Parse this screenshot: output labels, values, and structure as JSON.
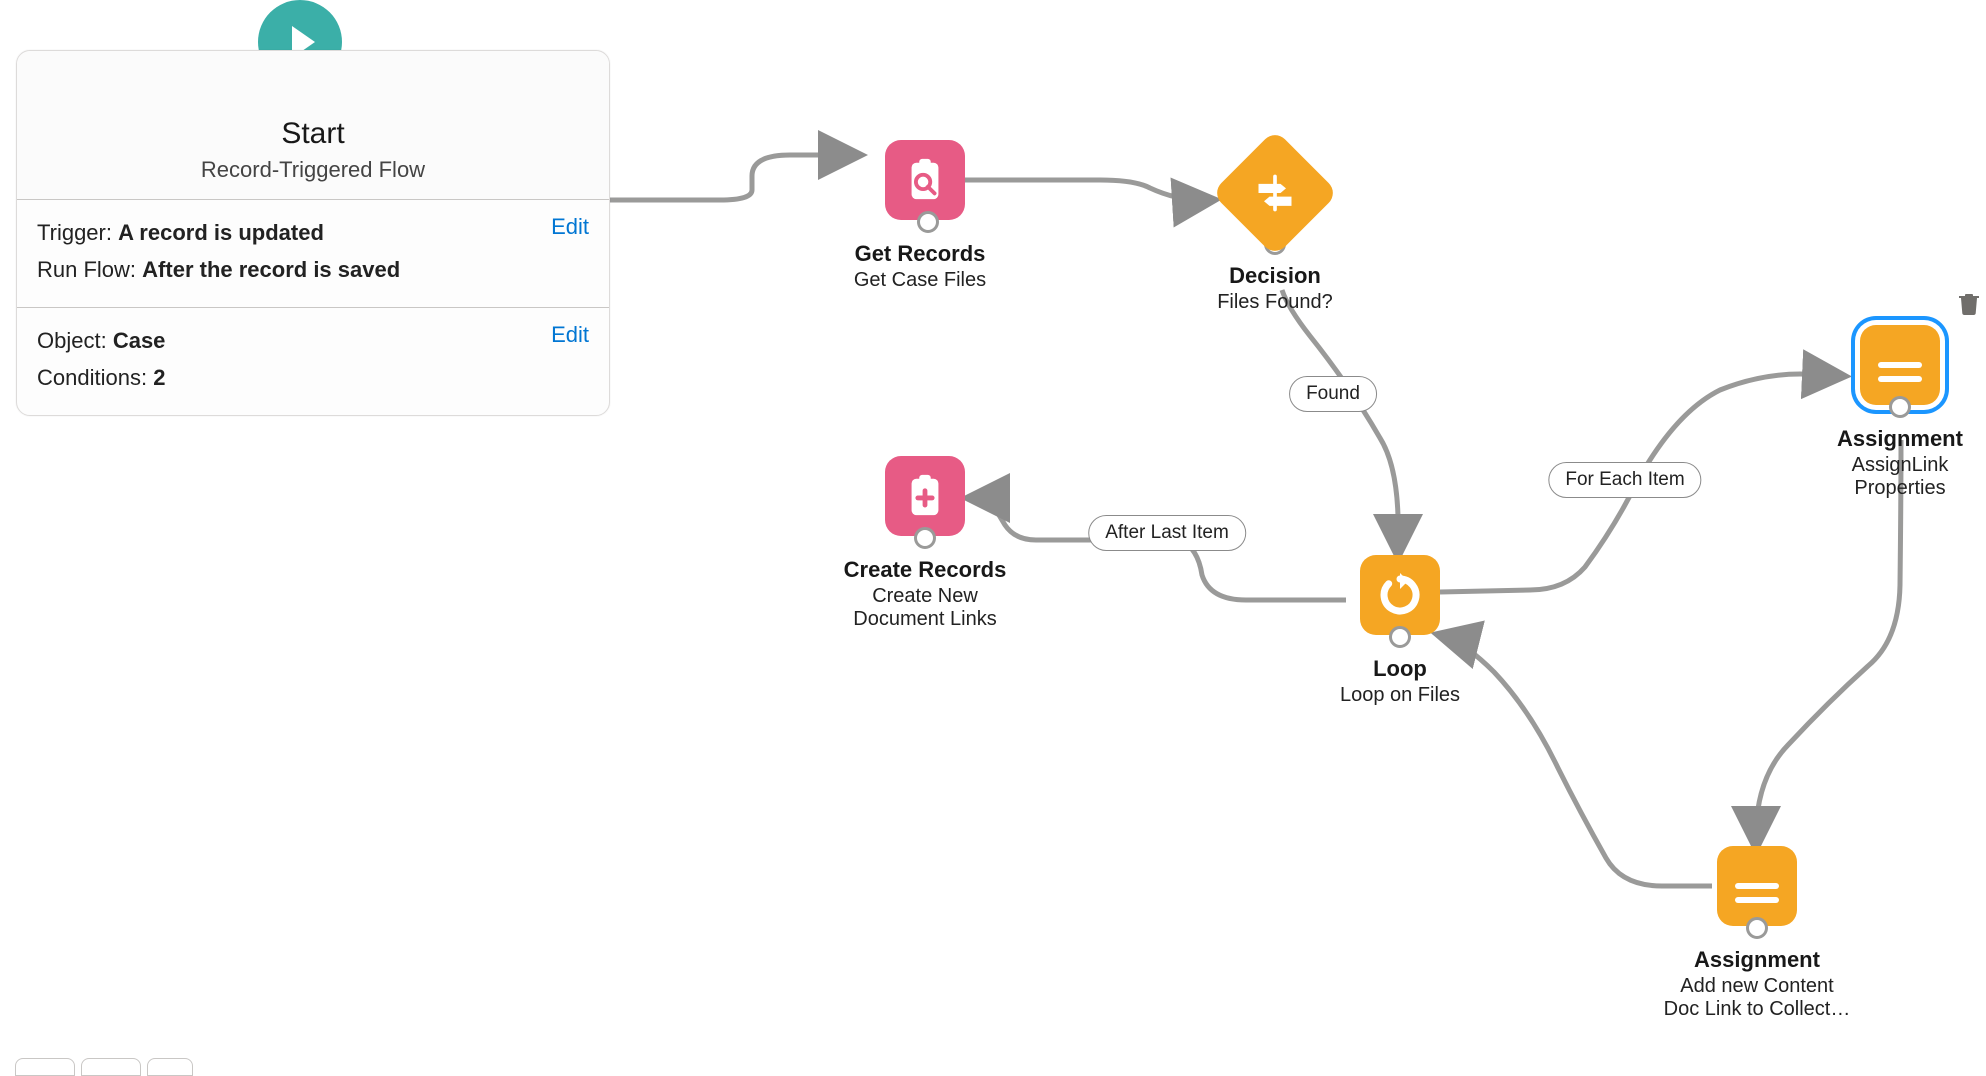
{
  "start": {
    "title": "Start",
    "subtitle": "Record-Triggered Flow",
    "sections": [
      {
        "edit_label": "Edit",
        "rows": [
          {
            "label": "Trigger:",
            "value": "A record is updated"
          },
          {
            "label": "Run Flow:",
            "value": "After the record is saved"
          }
        ]
      },
      {
        "edit_label": "Edit",
        "rows": [
          {
            "label": "Object:",
            "value": "Case"
          },
          {
            "label": "Conditions:",
            "value": "2"
          }
        ]
      }
    ]
  },
  "nodes": {
    "get_records": {
      "title": "Get Records",
      "sub1": "Get Case Files"
    },
    "decision": {
      "title": "Decision",
      "sub1": "Files Found?"
    },
    "loop": {
      "title": "Loop",
      "sub1": "Loop on Files"
    },
    "create": {
      "title": "Create Records",
      "sub1": "Create New",
      "sub2": "Document Links"
    },
    "assign_link": {
      "title": "Assignment",
      "sub1": "AssignLink",
      "sub2": "Properties"
    },
    "assign_add": {
      "title": "Assignment",
      "sub1": "Add new Content",
      "sub2": "Doc Link to Collect…"
    }
  },
  "edges": {
    "found_label": "Found",
    "for_each_label": "For Each Item",
    "after_last_label": "After Last Item"
  },
  "colors": {
    "teal": "#3bafa8",
    "pink": "#e75b85",
    "orange": "#f5a623",
    "connector": "#9a9a99",
    "selection": "#1b96ff"
  }
}
